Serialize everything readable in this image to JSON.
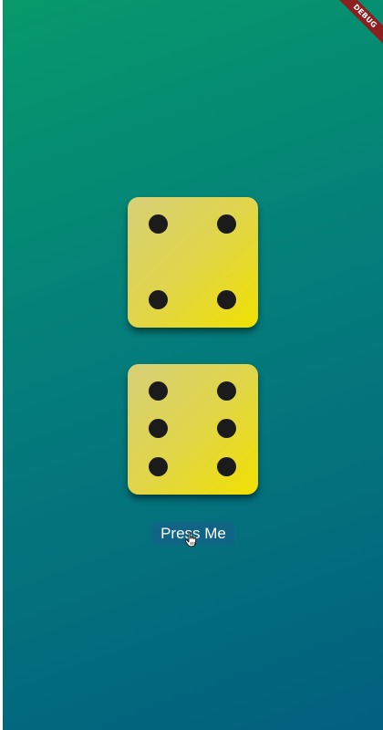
{
  "app": {
    "debug_banner": "DEBUG",
    "background_colors": [
      "#07996b",
      "#047d7b",
      "#03607f"
    ]
  },
  "dice": [
    {
      "face_value": 4,
      "color": "#f1e000",
      "pip_color": "#1b1b1b"
    },
    {
      "face_value": 6,
      "color": "#f1e000",
      "pip_color": "#1b1b1b"
    }
  ],
  "button": {
    "label": "Press Me"
  },
  "cursor": {
    "icon": "hand-pointer-icon"
  }
}
